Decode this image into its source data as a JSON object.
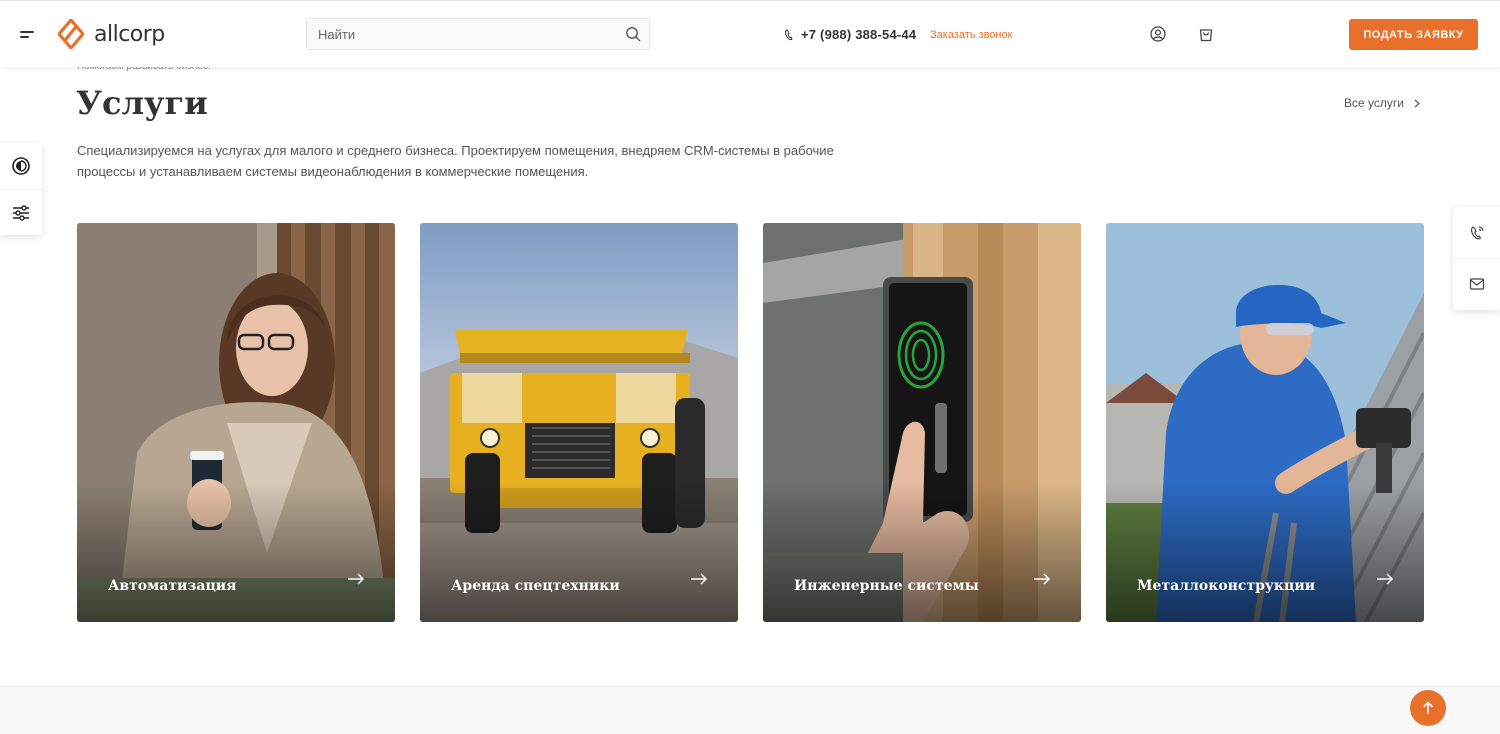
{
  "header": {
    "logo_text": "allcorp",
    "search_placeholder": "Найти",
    "phone": "+7 (988) 388-54-44",
    "callback_label": "Заказать звонок",
    "submit_label": "ПОДАТЬ ЗАЯВКУ"
  },
  "page": {
    "tagline": "Помогаем развивать бизнес.",
    "title": "Услуги",
    "all_services_label": "Все услуги",
    "description": "Специализируемся на услугах для малого и среднего бизнеса. Проектируем помещения, внедряем CRM-системы в рабочие процессы и устанавливаем системы видеонаблюдения в коммерческие помещения."
  },
  "cards": [
    {
      "title": "Автоматизация"
    },
    {
      "title": "Аренда спецтехники"
    },
    {
      "title": "Инженерные системы"
    },
    {
      "title": "Металлоконструкции"
    }
  ],
  "colors": {
    "accent": "#e8702a",
    "text": "#333333"
  },
  "icons": {
    "left_tabs": [
      "theme-toggle-icon",
      "settings-sliders-icon"
    ],
    "right_tabs": [
      "callback-phone-icon",
      "mail-icon"
    ],
    "header": [
      "menu-icon",
      "search-icon",
      "phone-icon",
      "user-icon",
      "cart-icon"
    ]
  }
}
